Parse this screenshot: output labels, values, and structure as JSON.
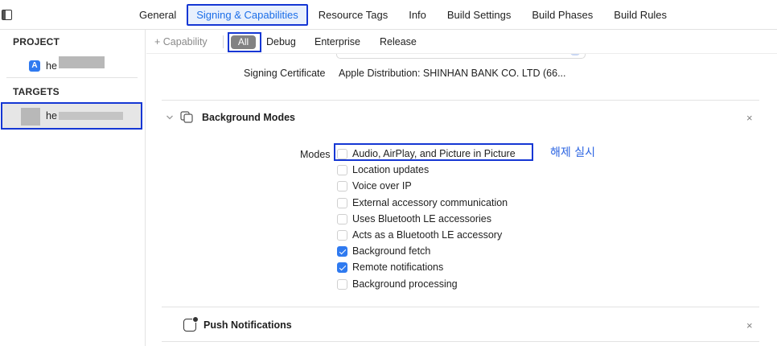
{
  "window": {
    "sidebar_toggle": "sidebar-toggle-icon"
  },
  "top_tabs": [
    {
      "label": "General",
      "active": false
    },
    {
      "label": "Signing & Capabilities",
      "active": true
    },
    {
      "label": "Resource Tags",
      "active": false
    },
    {
      "label": "Info",
      "active": false
    },
    {
      "label": "Build Settings",
      "active": false
    },
    {
      "label": "Build Phases",
      "active": false
    },
    {
      "label": "Build Rules",
      "active": false
    }
  ],
  "navigator": {
    "project_header": "PROJECT",
    "project_item": "he",
    "targets_header": "TARGETS",
    "target_item": "he"
  },
  "filter_bar": {
    "add_capability": "+ Capability",
    "filters": [
      "All",
      "Debug",
      "Enterprise",
      "Release"
    ],
    "selected": "All"
  },
  "signing": {
    "certificate_label": "Signing Certificate",
    "certificate_value": "Apple Distribution: SHINHAN BANK CO. LTD (66..."
  },
  "background_modes": {
    "title": "Background Modes",
    "modes_label": "Modes",
    "items": [
      {
        "label": "Audio, AirPlay, and Picture in Picture",
        "checked": false
      },
      {
        "label": "Location updates",
        "checked": false
      },
      {
        "label": "Voice over IP",
        "checked": false
      },
      {
        "label": "External accessory communication",
        "checked": false
      },
      {
        "label": "Uses Bluetooth LE accessories",
        "checked": false
      },
      {
        "label": "Acts as a Bluetooth LE accessory",
        "checked": false
      },
      {
        "label": "Background fetch",
        "checked": true
      },
      {
        "label": "Remote notifications",
        "checked": true
      },
      {
        "label": "Background processing",
        "checked": false
      }
    ],
    "annotation": "해제 실시"
  },
  "push_notifications": {
    "title": "Push Notifications"
  },
  "close_glyph": "×",
  "accent_color": "#2f7af0",
  "highlight_color": "#1537d4"
}
